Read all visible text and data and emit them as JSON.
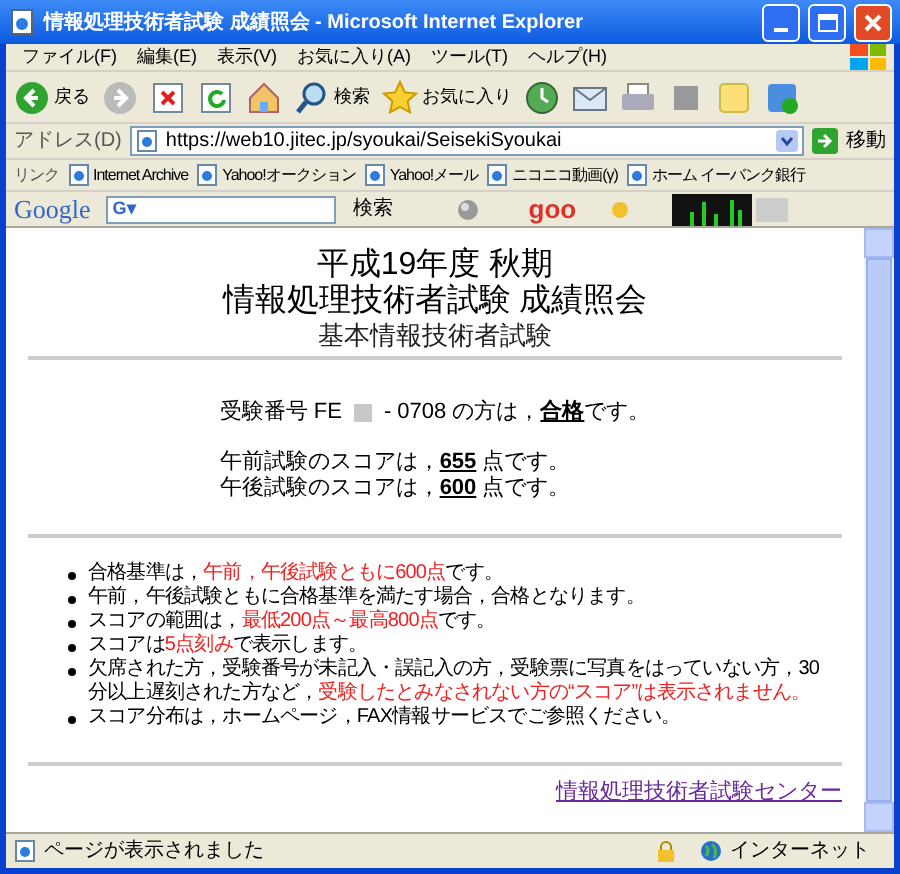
{
  "window": {
    "title": "情報処理技術者試験 成績照会 - Microsoft Internet Explorer"
  },
  "menu": [
    "ファイル(F)",
    "編集(E)",
    "表示(V)",
    "お気に入り(A)",
    "ツール(T)",
    "ヘルプ(H)"
  ],
  "toolbar": [
    {
      "kind": "back",
      "label": "戻る"
    },
    {
      "kind": "forward"
    },
    {
      "kind": "stop"
    },
    {
      "kind": "refresh"
    },
    {
      "kind": "home"
    },
    {
      "kind": "search",
      "label": "検索"
    },
    {
      "kind": "favorites",
      "label": "お気に入り"
    },
    {
      "kind": "history"
    },
    {
      "kind": "mail"
    },
    {
      "kind": "print"
    },
    {
      "kind": "edit"
    },
    {
      "kind": "note"
    },
    {
      "kind": "messenger"
    }
  ],
  "address": {
    "label": "アドレス(D)",
    "url": "https://web10.jitec.jp/syoukai/SeisekiSyoukai",
    "go": "移動"
  },
  "links": {
    "label": "リンク",
    "items": [
      "Internet Archive",
      "Yahoo!オークション",
      "Yahoo!メール",
      "ニコニコ動画(γ)",
      "ホーム イーバンク銀行"
    ]
  },
  "google_bar": {
    "logo": "Google",
    "field_icon": "G▾",
    "search": "検索",
    "goo_logo": "goo"
  },
  "page": {
    "heading": [
      "平成19年度 秋期",
      "情報処理技術者試験 成績照会"
    ],
    "subheading": "基本情報技術者試験",
    "result": {
      "prefix": "受験番号 FE",
      "suffix": "- 0708 の方は，**合格**です。"
    },
    "scores": [
      "午前試験のスコアは，**655** 点です。",
      "午後試験のスコアは，**600** 点です。"
    ],
    "notes": [
      [
        {
          "text": "合格基準は，",
          "emphasis": false
        },
        {
          "text": "午前，午後試験ともに600点",
          "emphasis": true
        },
        {
          "text": "です。",
          "emphasis": false
        }
      ],
      [
        {
          "text": "午前，午後試験ともに合格基準を満たす場合，合格となります。",
          "emphasis": false
        }
      ],
      [
        {
          "text": "スコアの範囲は，",
          "emphasis": false
        },
        {
          "text": "最低200点～最高800点",
          "emphasis": true
        },
        {
          "text": "です。",
          "emphasis": false
        }
      ],
      [
        {
          "text": "スコアは",
          "emphasis": false
        },
        {
          "text": "5点刻み",
          "emphasis": true
        },
        {
          "text": "で表示します。",
          "emphasis": false
        }
      ],
      [
        {
          "text": "欠席された方，受験番号が未記入・誤記入の方，受験票に写真をはっていない方，30分以上遅刻された方など，",
          "emphasis": false
        },
        {
          "text": "受験したとみなされない方の“スコア”は表示されません。",
          "emphasis": true
        }
      ],
      [
        {
          "text": "スコア分布は，ホームページ，FAX情報サービスでご参照ください。",
          "emphasis": false
        }
      ]
    ],
    "footer_link": "情報処理技術者試験センター"
  },
  "status_bar": {
    "text": "ページが表示されました",
    "zone": "インターネット"
  }
}
